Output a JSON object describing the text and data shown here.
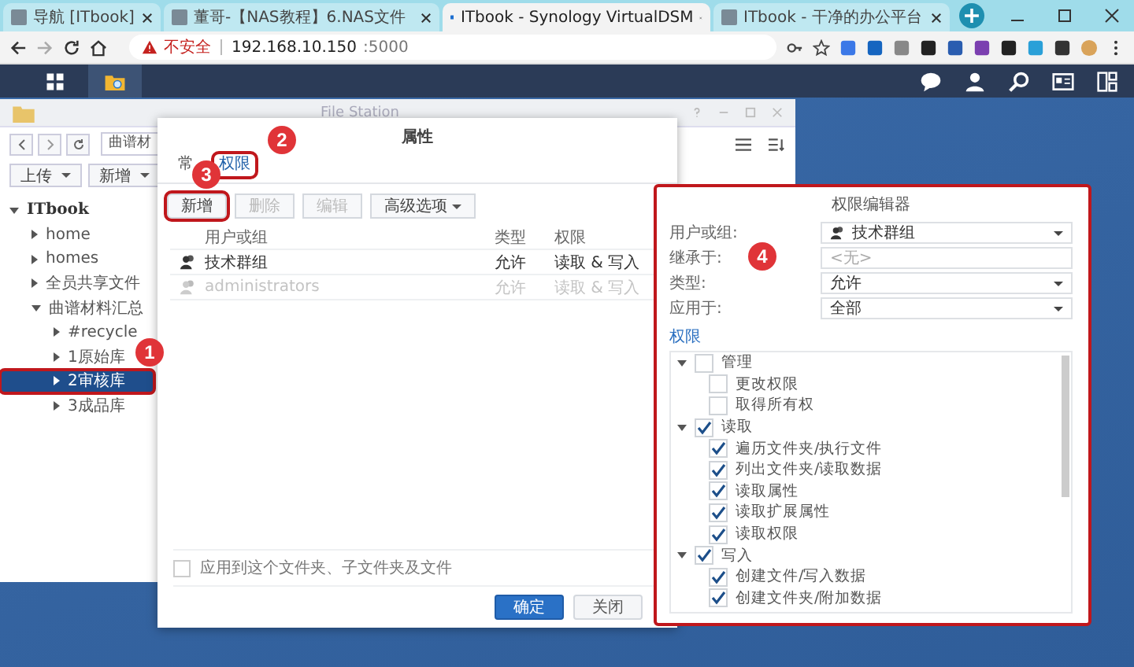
{
  "browser": {
    "tabs": [
      {
        "label": "导航 [ITbook]",
        "selected": false
      },
      {
        "label": "董哥-【NAS教程】6.NAS文件",
        "selected": false
      },
      {
        "label": "ITbook - Synology VirtualDSM",
        "selected": true
      },
      {
        "label": "ITbook - 干净的办公平台",
        "selected": false
      }
    ],
    "security": "不安全",
    "host": "192.168.10.150",
    "port": ":5000"
  },
  "file_station": {
    "title": "File Station",
    "path": "曲谱材",
    "toolbar": [
      "上传",
      "新增"
    ],
    "tree": [
      {
        "label": "ITbook",
        "expanded": true,
        "selected": false,
        "children": [
          {
            "label": "home",
            "expanded": false,
            "selected": false
          },
          {
            "label": "homes",
            "expanded": false,
            "selected": false
          },
          {
            "label": "全员共享文件",
            "expanded": false,
            "selected": false
          },
          {
            "label": "曲谱材料汇总",
            "expanded": true,
            "selected": false,
            "children": [
              {
                "label": "#recycle",
                "expanded": false,
                "selected": false
              },
              {
                "label": "1原始库",
                "expanded": false,
                "selected": false
              },
              {
                "label": "2审核库",
                "expanded": false,
                "selected": true
              },
              {
                "label": "3成品库",
                "expanded": false,
                "selected": false
              }
            ]
          }
        ]
      }
    ]
  },
  "properties": {
    "title": "属性",
    "tabs": [
      {
        "label": "常",
        "selected": false
      },
      {
        "label": "权限",
        "selected": true
      }
    ],
    "buttons": [
      {
        "label": "新增",
        "disabled": false,
        "dropdown": false
      },
      {
        "label": "删除",
        "disabled": true,
        "dropdown": false
      },
      {
        "label": "编辑",
        "disabled": true,
        "dropdown": false
      },
      {
        "label": "高级选项",
        "disabled": false,
        "dropdown": true
      }
    ],
    "columns": [
      "用户或组",
      "类型",
      "权限"
    ],
    "rows": [
      {
        "cells": [
          "技术群组",
          "允许",
          "读取 & 写入"
        ],
        "disabled": false
      },
      {
        "cells": [
          "administrators",
          "允许",
          "读取 & 写入"
        ],
        "disabled": true
      }
    ],
    "apply_all": {
      "label": "应用到这个文件夹、子文件夹及文件",
      "checked": false
    },
    "footer": [
      {
        "label": "确定",
        "kind": "primary"
      },
      {
        "label": "关闭",
        "kind": "secondary"
      }
    ]
  },
  "editor": {
    "title": "权限编辑器",
    "fields": [
      {
        "label": "用户或组:",
        "kind": "user_select",
        "value": "技术群组"
      },
      {
        "label": "继承于:",
        "kind": "text",
        "placeholder": "<无>"
      },
      {
        "label": "类型:",
        "kind": "select",
        "value": "允许"
      },
      {
        "label": "应用于:",
        "kind": "select",
        "value": "全部"
      }
    ],
    "section": "权限",
    "permissions": [
      {
        "label": "管理",
        "checked": false,
        "expanded": true,
        "children": [
          {
            "label": "更改权限",
            "checked": false
          },
          {
            "label": "取得所有权",
            "checked": false
          }
        ]
      },
      {
        "label": "读取",
        "checked": true,
        "expanded": true,
        "children": [
          {
            "label": "遍历文件夹/执行文件",
            "checked": true
          },
          {
            "label": "列出文件夹/读取数据",
            "checked": true
          },
          {
            "label": "读取属性",
            "checked": true
          },
          {
            "label": "读取扩展属性",
            "checked": true
          },
          {
            "label": "读取权限",
            "checked": true
          }
        ]
      },
      {
        "label": "写入",
        "checked": true,
        "expanded": true,
        "children": [
          {
            "label": "创建文件/写入数据",
            "checked": true
          },
          {
            "label": "创建文件夹/附加数据",
            "checked": true
          }
        ]
      }
    ]
  },
  "annotations": [
    "1",
    "2",
    "3",
    "4"
  ]
}
